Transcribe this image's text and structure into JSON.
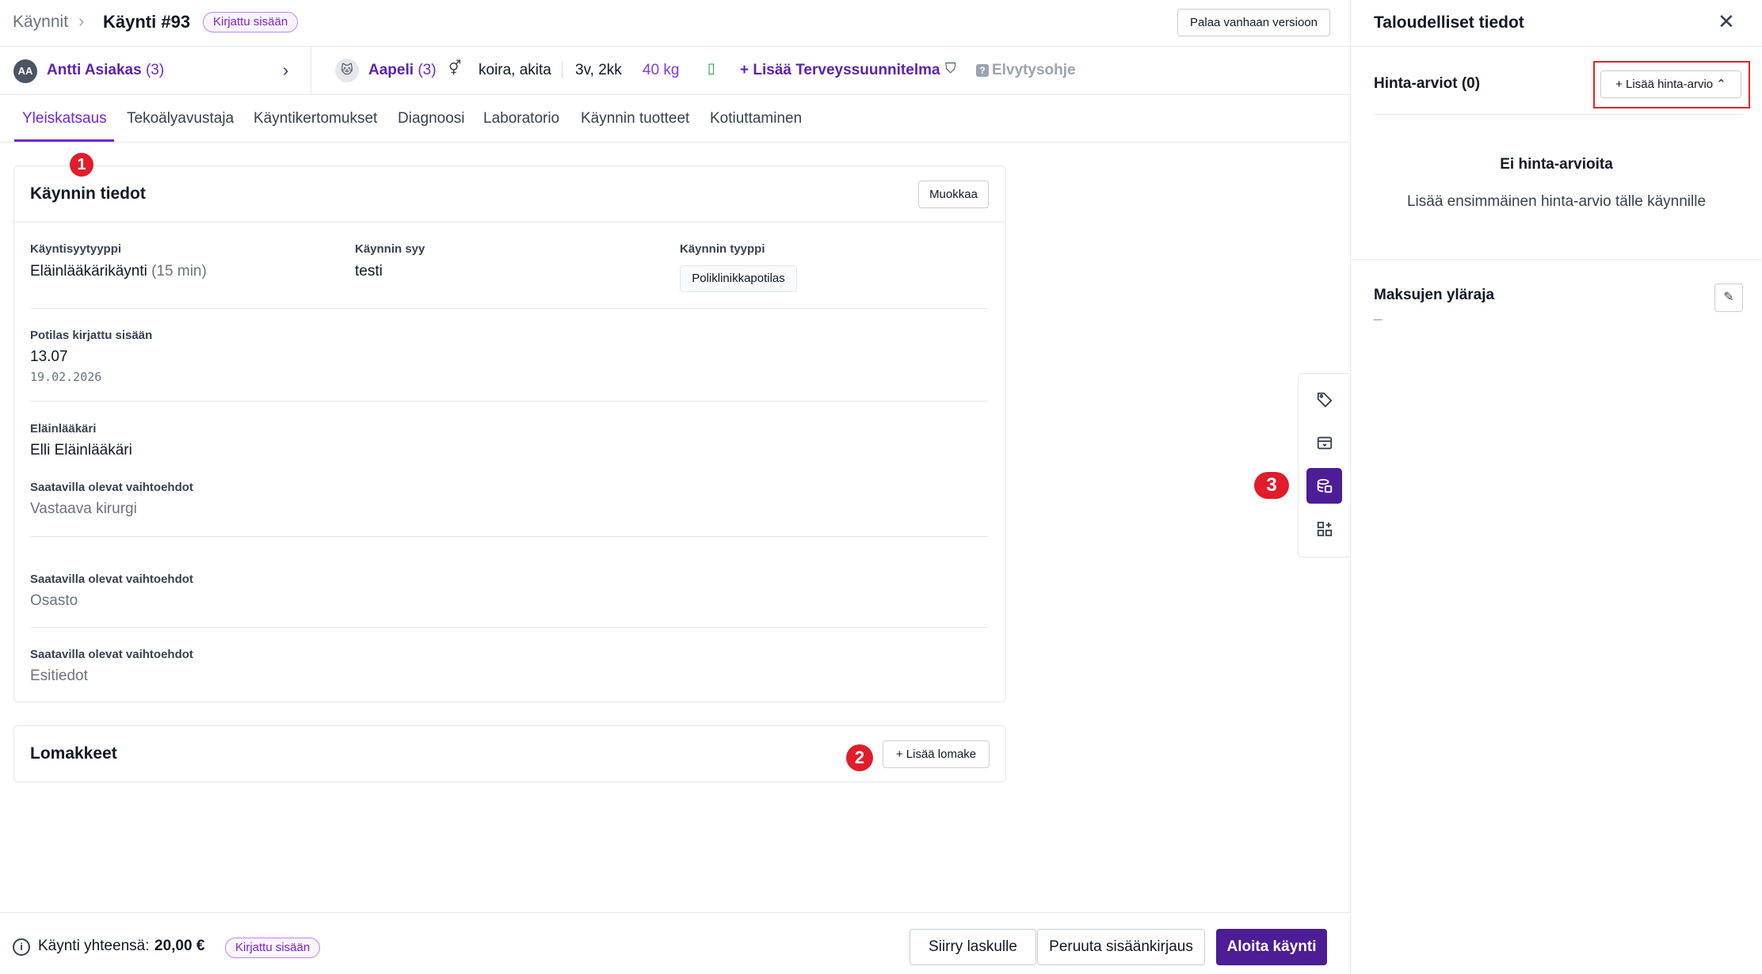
{
  "header": {
    "breadcrumb_root": "Käynnit",
    "breadcrumb_sep": "›",
    "title": "Käynti #93",
    "status_badge": "Kirjattu sisään",
    "old_version_label": "Palaa vanhaan versioon"
  },
  "client": {
    "initials": "AA",
    "name": "Antti Asiakas",
    "count": "(3)",
    "chevron": "›"
  },
  "pet": {
    "avatar_glyph": "🐱",
    "name": "Aapeli",
    "count": "(3)",
    "sex_icon_glyph": "⚥",
    "species": "koira, akita",
    "age": "3v, 2kk",
    "weight": "40 kg",
    "chip_icon_glyph": "▯",
    "add_health_plan": "+ Lisää Terveyssuunnitelma",
    "shield_icon_glyph": "⛉",
    "resuscitation": "Elvytysohje",
    "resuscitation_icon": "?"
  },
  "tabs": [
    {
      "label": "Yleiskatsaus",
      "active": true
    },
    {
      "label": "Tekoälyavustaja"
    },
    {
      "label": "Käyntikertomukset"
    },
    {
      "label": "Diagnoosi"
    },
    {
      "label": "Laboratorio"
    },
    {
      "label": "Käynnin tuotteet"
    },
    {
      "label": "Kotiuttaminen"
    }
  ],
  "visit_card": {
    "title": "Käynnin tiedot",
    "edit_label": "Muokkaa",
    "reason_type_label": "Käyntisyytyyppi",
    "reason_type_value": "Eläinlääkärikäynti",
    "reason_type_duration": "(15 min)",
    "reason_label": "Käynnin syy",
    "reason_value": "testi",
    "visit_type_label": "Käynnin tyyppi",
    "visit_type_value": "Poliklinikkapotilas",
    "checkin_label": "Potilas kirjattu sisään",
    "checkin_time": "13.07",
    "checkin_date": "19.02.2026",
    "vet_label": "Eläinlääkäri",
    "vet_value": "Elli Eläinlääkäri",
    "options_label_1": "Saatavilla olevat vaihtoehdot",
    "options_value_1": "Vastaava kirurgi",
    "options_label_2": "Saatavilla olevat vaihtoehdot",
    "options_value_2": "Osasto",
    "options_label_3": "Saatavilla olevat vaihtoehdot",
    "options_value_3": "Esitiedot"
  },
  "forms_card": {
    "title": "Lomakkeet",
    "add_label": "+ Lisää lomake"
  },
  "markers": {
    "one": "1",
    "two": "2",
    "three": "3"
  },
  "tool_rail": {
    "tag_icon": "⌂",
    "inbox_icon": "▭",
    "finance_icon": "≋",
    "apps_icon": "▦"
  },
  "footer": {
    "info_icon": "i",
    "total_label": "Käynti yhteensä:",
    "total_value": "20,00 €",
    "status_badge": "Kirjattu sisään",
    "invoice_label": "Siirry laskulle",
    "cancel_checkin_label": "Peruuta sisäänkirjaus",
    "start_visit_label": "Aloita käynti"
  },
  "panel": {
    "title": "Taloudelliset tiedot",
    "close_glyph": "✕",
    "estimates_title": "Hinta-arviot (0)",
    "add_estimate_label": "+ Lisää hinta-arvio ⌃",
    "empty_title": "Ei hinta-arvioita",
    "empty_text": "Lisää ensimmäinen hinta-arvio tälle käynnille",
    "fee_title": "Maksujen yläraja",
    "fee_value": "–",
    "fee_edit_glyph": "✎"
  },
  "colors": {
    "accent": "#6d28d9",
    "primary_button": "#4c1d95",
    "marker": "#e11d2b",
    "highlight": "#dc2626"
  }
}
